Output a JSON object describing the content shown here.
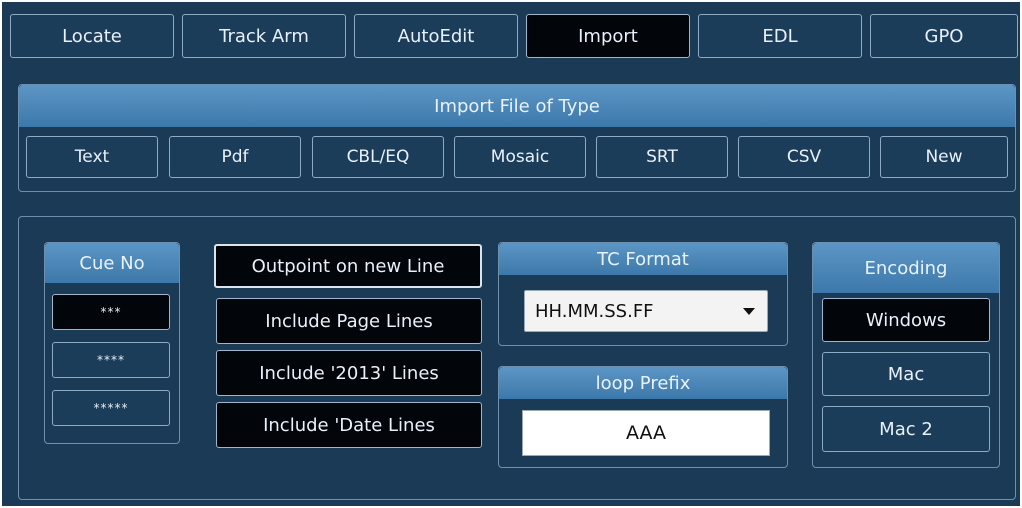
{
  "top_tabs": [
    {
      "label": "Locate"
    },
    {
      "label": "Track Arm"
    },
    {
      "label": "AutoEdit"
    },
    {
      "label": "Import"
    },
    {
      "label": "EDL"
    },
    {
      "label": "GPO"
    }
  ],
  "import_type": {
    "title": "Import File of Type",
    "buttons": [
      {
        "label": "Text"
      },
      {
        "label": "Pdf"
      },
      {
        "label": "CBL/EQ"
      },
      {
        "label": "Mosaic"
      },
      {
        "label": "SRT"
      },
      {
        "label": "CSV"
      },
      {
        "label": "New"
      }
    ]
  },
  "cue_no": {
    "title": "Cue No",
    "options": [
      {
        "label": "***"
      },
      {
        "label": "****"
      },
      {
        "label": "*****"
      }
    ]
  },
  "line_options": [
    {
      "label": "Outpoint on new Line"
    },
    {
      "label": "Include Page Lines"
    },
    {
      "label": "Include '2013' Lines"
    },
    {
      "label": "Include 'Date Lines"
    }
  ],
  "tc_format": {
    "title": "TC Format",
    "value": "HH.MM.SS.FF"
  },
  "loop_prefix": {
    "title": "loop Prefix",
    "value": "AAA"
  },
  "encoding": {
    "title": "Encoding",
    "options": [
      {
        "label": "Windows"
      },
      {
        "label": "Mac"
      },
      {
        "label": "Mac 2"
      }
    ]
  },
  "colors": {
    "background": "#1b3a56",
    "header": "#4d88b8",
    "selected": "#02050a"
  }
}
